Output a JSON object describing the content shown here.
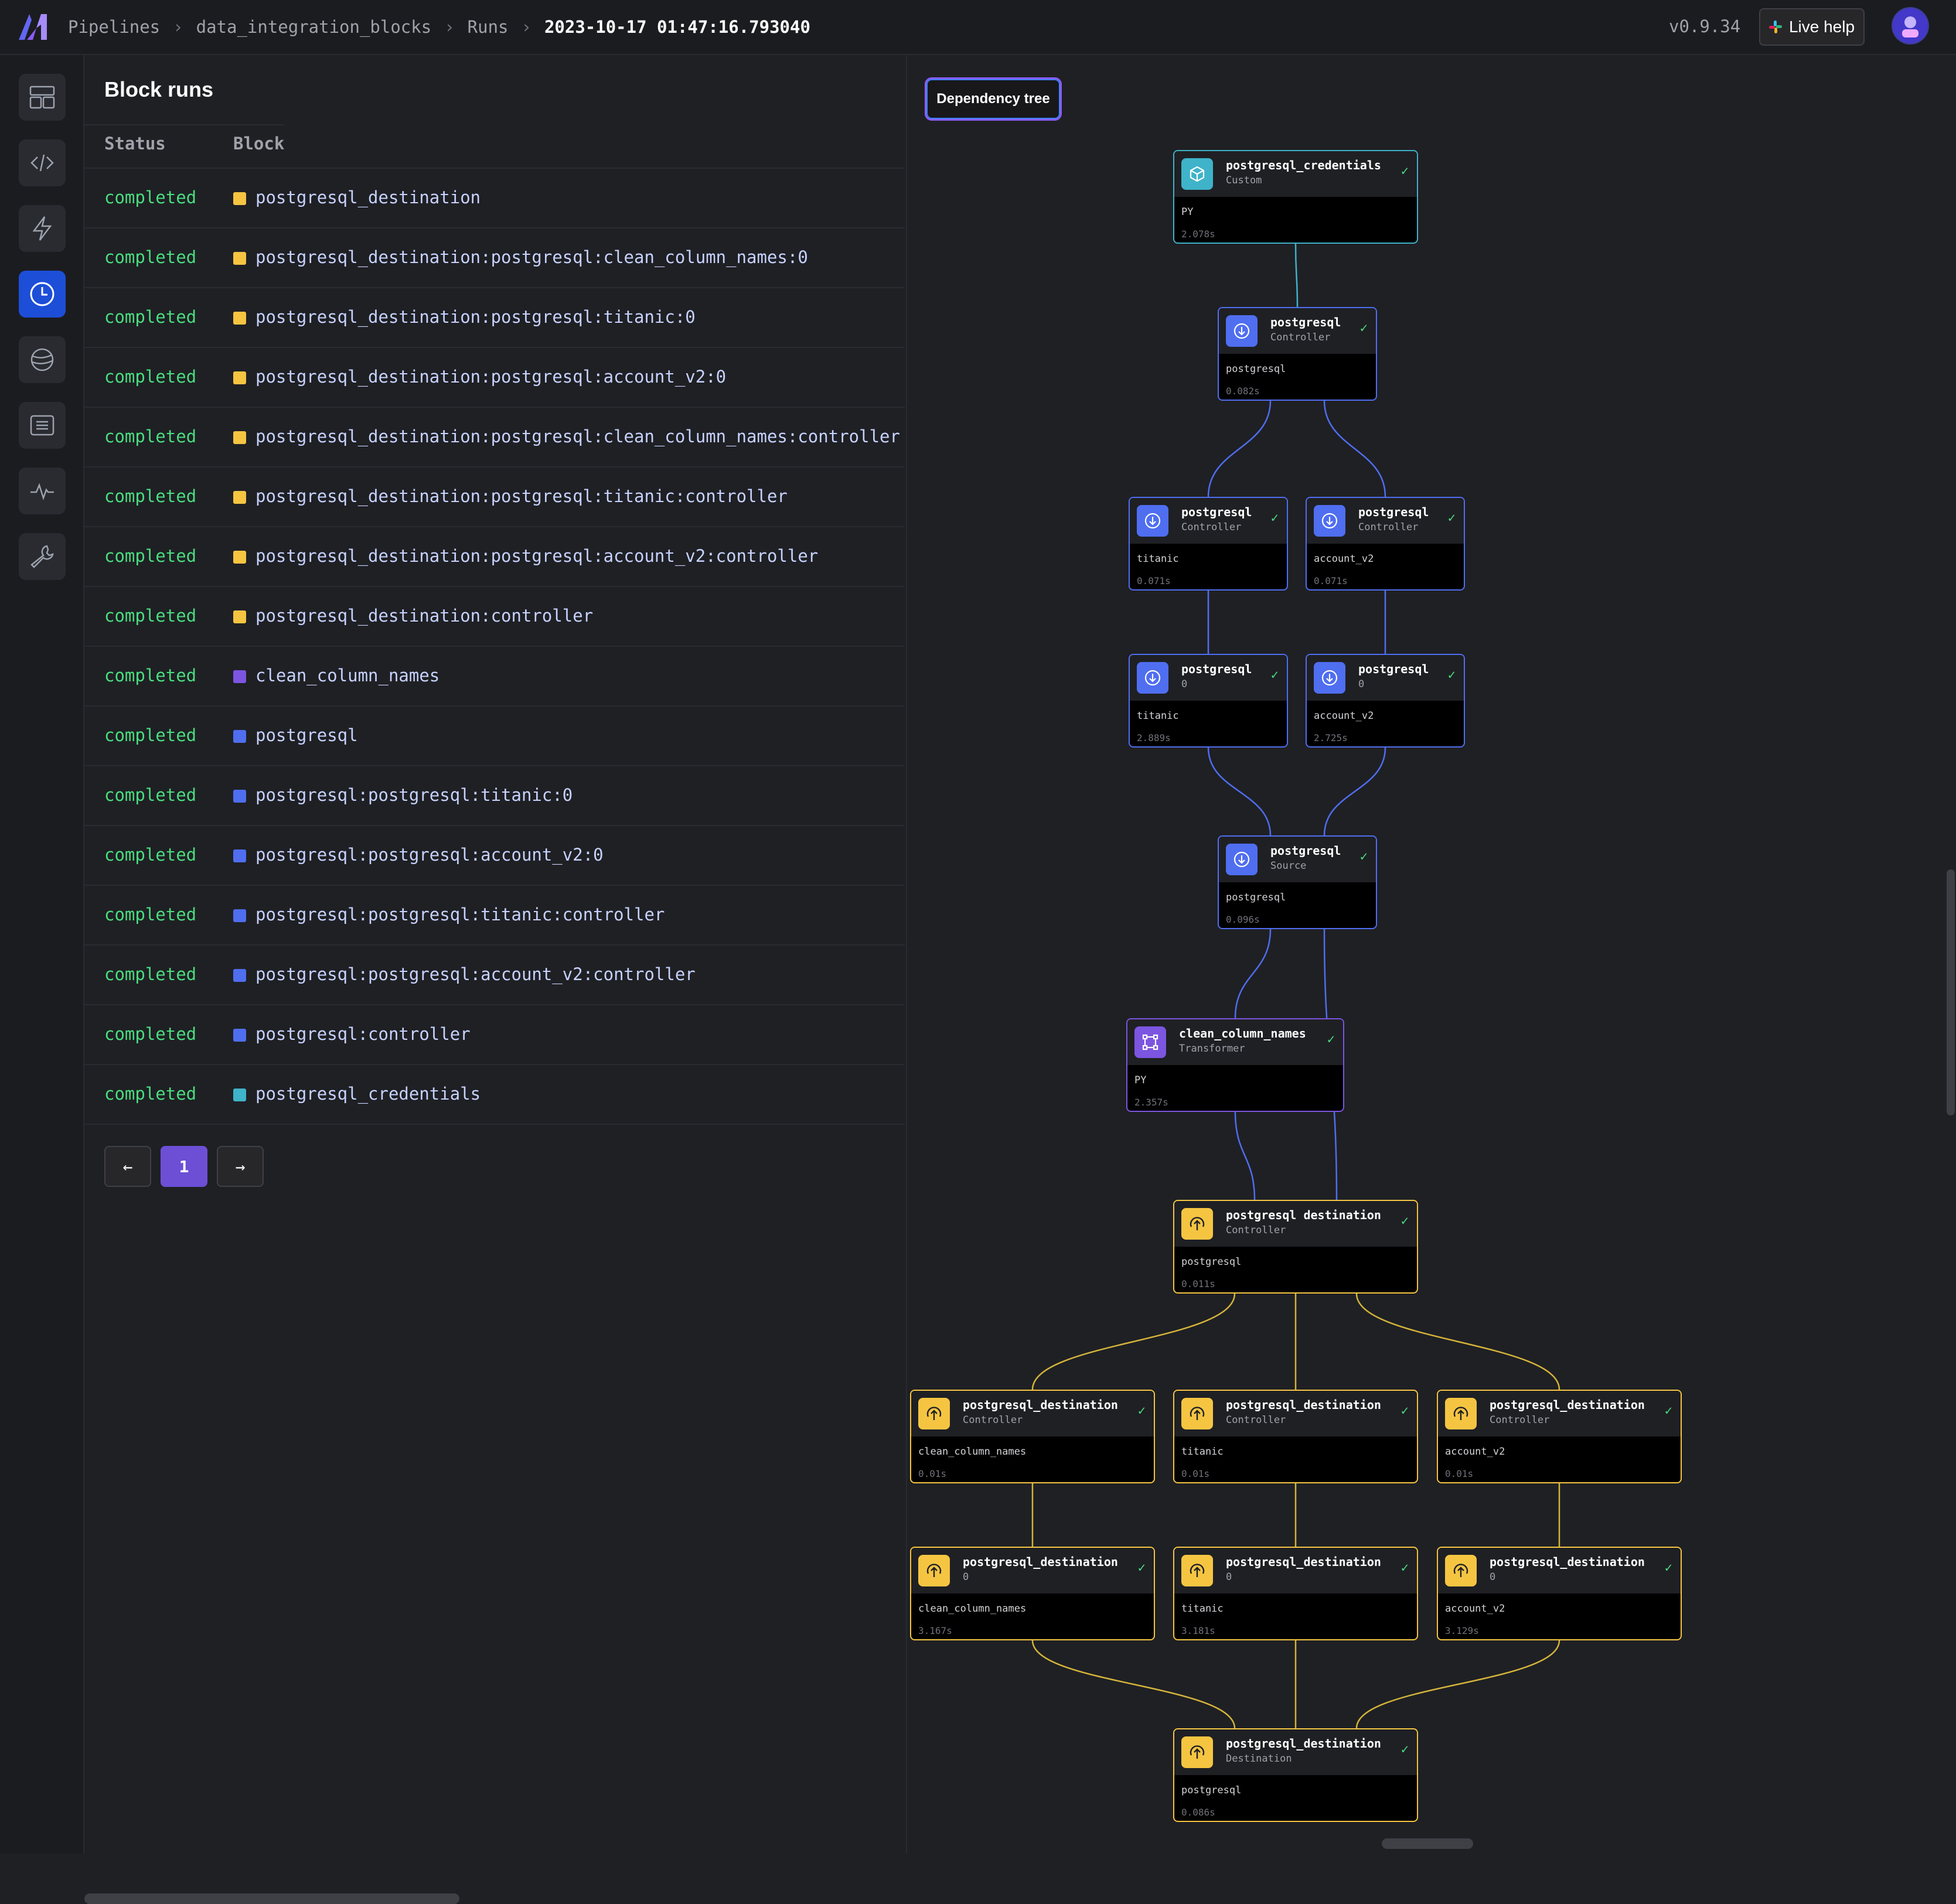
{
  "header": {
    "breadcrumb": [
      "Pipelines",
      "data_integration_blocks",
      "Runs",
      "2023-10-17 01:47:16.793040"
    ],
    "version": "v0.9.34",
    "live_help": "Live help"
  },
  "nav": {
    "items": [
      "layout-icon",
      "code-icon",
      "trigger-icon",
      "runs-clock-icon",
      "globe-icon",
      "terminal-icon",
      "monitor-pulse-icon",
      "wrench-icon"
    ],
    "active_index": 3
  },
  "runs": {
    "title": "Block runs",
    "columns": [
      "Status",
      "Block"
    ],
    "rows": [
      {
        "status": "completed",
        "block": "postgresql_destination",
        "color": "#f5c542"
      },
      {
        "status": "completed",
        "block": "postgresql_destination:postgresql:clean_column_names:0",
        "color": "#f5c542"
      },
      {
        "status": "completed",
        "block": "postgresql_destination:postgresql:titanic:0",
        "color": "#f5c542"
      },
      {
        "status": "completed",
        "block": "postgresql_destination:postgresql:account_v2:0",
        "color": "#f5c542"
      },
      {
        "status": "completed",
        "block": "postgresql_destination:postgresql:clean_column_names:controller",
        "color": "#f5c542"
      },
      {
        "status": "completed",
        "block": "postgresql_destination:postgresql:titanic:controller",
        "color": "#f5c542"
      },
      {
        "status": "completed",
        "block": "postgresql_destination:postgresql:account_v2:controller",
        "color": "#f5c542"
      },
      {
        "status": "completed",
        "block": "postgresql_destination:controller",
        "color": "#f5c542"
      },
      {
        "status": "completed",
        "block": "clean_column_names",
        "color": "#7c55e0"
      },
      {
        "status": "completed",
        "block": "postgresql",
        "color": "#4f6ef0"
      },
      {
        "status": "completed",
        "block": "postgresql:postgresql:titanic:0",
        "color": "#4f6ef0"
      },
      {
        "status": "completed",
        "block": "postgresql:postgresql:account_v2:0",
        "color": "#4f6ef0"
      },
      {
        "status": "completed",
        "block": "postgresql:postgresql:titanic:controller",
        "color": "#4f6ef0"
      },
      {
        "status": "completed",
        "block": "postgresql:postgresql:account_v2:controller",
        "color": "#4f6ef0"
      },
      {
        "status": "completed",
        "block": "postgresql:controller",
        "color": "#4f6ef0"
      },
      {
        "status": "completed",
        "block": "postgresql_credentials",
        "color": "#3fb3c9"
      }
    ],
    "pager": {
      "prev": "←",
      "page": "1",
      "next": "→"
    }
  },
  "tree": {
    "tab": "Dependency tree",
    "nodes": [
      {
        "id": "cred",
        "name": "postgresql_credentials",
        "sub": "Custom",
        "label": "PY",
        "dur": "2.078s",
        "kind": "custom"
      },
      {
        "id": "src_ctrl",
        "name": "postgresql",
        "sub": "Controller",
        "label": "postgresql",
        "dur": "0.082s",
        "kind": "source"
      },
      {
        "id": "src_t_ctrl",
        "name": "postgresql",
        "sub": "Controller",
        "label": "titanic",
        "dur": "0.071s",
        "kind": "source"
      },
      {
        "id": "src_a_ctrl",
        "name": "postgresql",
        "sub": "Controller",
        "label": "account_v2",
        "dur": "0.071s",
        "kind": "source"
      },
      {
        "id": "src_t_0",
        "name": "postgresql",
        "sub": "0",
        "label": "titanic",
        "dur": "2.889s",
        "kind": "source"
      },
      {
        "id": "src_a_0",
        "name": "postgresql",
        "sub": "0",
        "label": "account_v2",
        "dur": "2.725s",
        "kind": "source"
      },
      {
        "id": "src",
        "name": "postgresql",
        "sub": "Source",
        "label": "postgresql",
        "dur": "0.096s",
        "kind": "source"
      },
      {
        "id": "tr",
        "name": "clean_column_names",
        "sub": "Transformer",
        "label": "PY",
        "dur": "2.357s",
        "kind": "transformer"
      },
      {
        "id": "dst_ctrl",
        "name": "postgresql destination",
        "sub": "Controller",
        "label": "postgresql",
        "dur": "0.011s",
        "kind": "dest"
      },
      {
        "id": "dst_c_ctrl",
        "name": "postgresql_destination",
        "sub": "Controller",
        "label": "clean_column_names",
        "dur": "0.01s",
        "kind": "dest"
      },
      {
        "id": "dst_t_ctrl",
        "name": "postgresql_destination",
        "sub": "Controller",
        "label": "titanic",
        "dur": "0.01s",
        "kind": "dest"
      },
      {
        "id": "dst_a_ctrl",
        "name": "postgresql_destination",
        "sub": "Controller",
        "label": "account_v2",
        "dur": "0.01s",
        "kind": "dest"
      },
      {
        "id": "dst_c_0",
        "name": "postgresql_destination",
        "sub": "0",
        "label": "clean_column_names",
        "dur": "3.167s",
        "kind": "dest"
      },
      {
        "id": "dst_t_0",
        "name": "postgresql_destination",
        "sub": "0",
        "label": "titanic",
        "dur": "3.181s",
        "kind": "dest"
      },
      {
        "id": "dst_a_0",
        "name": "postgresql_destination",
        "sub": "0",
        "label": "account_v2",
        "dur": "3.129s",
        "kind": "dest"
      },
      {
        "id": "dst",
        "name": "postgresql_destination",
        "sub": "Destination",
        "label": "postgresql",
        "dur": "0.086s",
        "kind": "dest"
      }
    ],
    "kind_colors": {
      "custom": "#3fb3c9",
      "source": "#4f6ef0",
      "transformer": "#7c55e0",
      "dest": "#f5c542"
    },
    "edge_colors": {
      "custom": "#3fb3c9",
      "source": "#4f6ef0",
      "dest": "#d4b43a"
    }
  }
}
